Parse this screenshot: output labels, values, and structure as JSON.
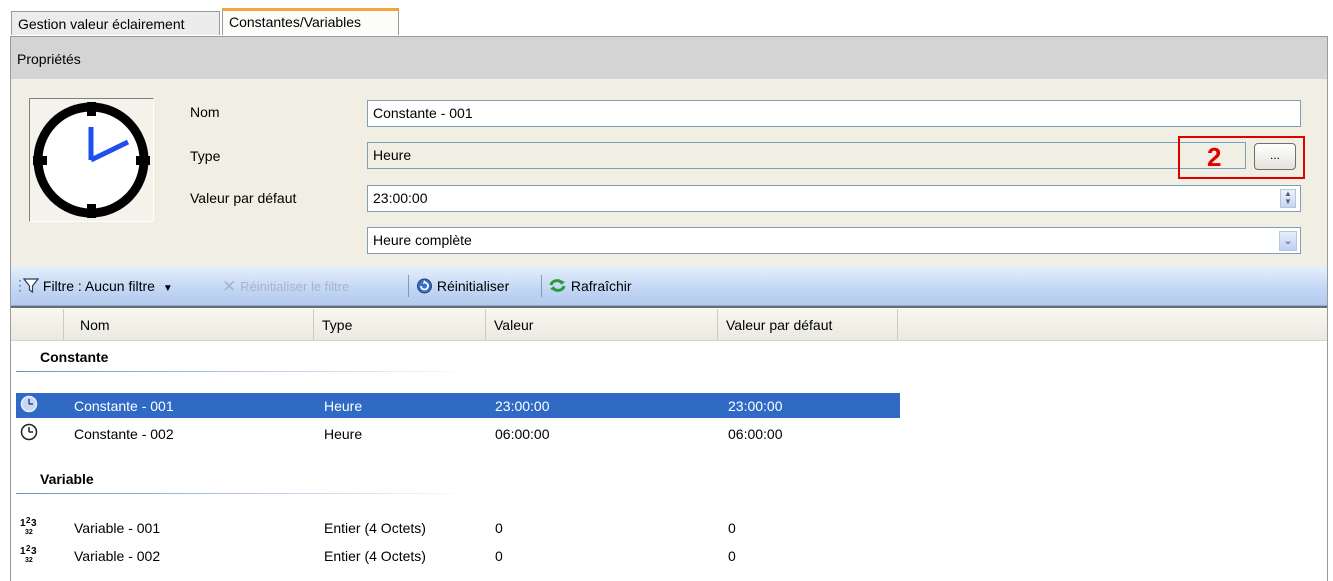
{
  "tabs": [
    {
      "label": "Gestion valeur éclairement",
      "active": false
    },
    {
      "label": "Constantes/Variables",
      "active": true
    }
  ],
  "properties": {
    "title": "Propriétés",
    "name_label": "Nom",
    "name_value": "Constante - 001",
    "type_label": "Type",
    "type_value": "Heure",
    "type_button": "...",
    "default_label": "Valeur par défaut",
    "default_value": "23:00:00",
    "format_value": "Heure complète",
    "annotation": "2"
  },
  "toolbar": {
    "filter": "Filtre : Aucun filtre",
    "reset_filter": "Réinitialiser le filtre",
    "reset": "Réinitialiser",
    "refresh": "Rafraîchir"
  },
  "grid": {
    "columns": [
      "Nom",
      "Type",
      "Valeur",
      "Valeur par défaut"
    ],
    "groups": [
      {
        "title": "Constante",
        "rows": [
          {
            "icon": "clock-icon",
            "name": "Constante - 001",
            "type": "Heure",
            "value": "23:00:00",
            "default": "23:00:00",
            "selected": true
          },
          {
            "icon": "clock-icon",
            "name": "Constante - 002",
            "type": "Heure",
            "value": "06:00:00",
            "default": "06:00:00",
            "selected": false
          }
        ]
      },
      {
        "title": "Variable",
        "rows": [
          {
            "icon": "integer-icon",
            "name": "Variable - 001",
            "type": "Entier (4 Octets)",
            "value": "0",
            "default": "0",
            "selected": false
          },
          {
            "icon": "integer-icon",
            "name": "Variable - 002",
            "type": "Entier (4 Octets)",
            "value": "0",
            "default": "0",
            "selected": false
          }
        ]
      }
    ]
  },
  "colors": {
    "selection": "#316ac5",
    "annotation": "#e00000",
    "active_tab_accent": "#f2a53a"
  }
}
